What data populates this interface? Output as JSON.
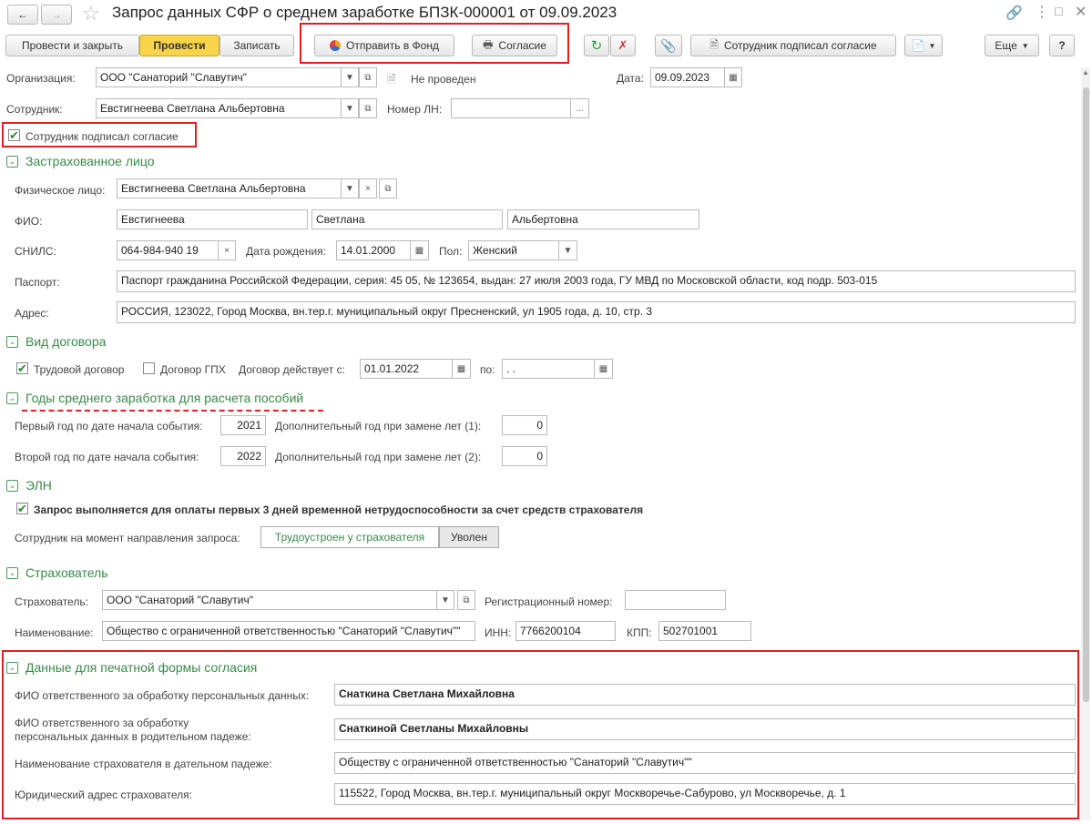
{
  "window": {
    "title": "Запрос данных СФР о среднем заработке  БПЗК-000001 от 09.09.2023"
  },
  "toolbar": {
    "post_close": "Провести и закрыть",
    "post": "Провести",
    "write": "Записать",
    "send_fund": "Отправить в Фонд",
    "consent": "Согласие",
    "employee_signed": "Сотрудник подписал согласие",
    "more": "Еще",
    "help": "?"
  },
  "header": {
    "org_label": "Организация:",
    "org_value": "ООО \"Санаторий \"Славутич\"",
    "status": "Не проведен",
    "date_label": "Дата:",
    "date_value": "09.09.2023",
    "employee_label": "Сотрудник:",
    "employee_value": "Евстигнеева Светлана Альбертовна",
    "ln_label": "Номер ЛН:",
    "ln_value": "",
    "signed_checkbox": "Сотрудник подписал согласие"
  },
  "insured": {
    "section": "Застрахованное лицо",
    "person_label": "Физическое лицо:",
    "person_value": "Евстигнеева Светлана Альбертовна",
    "fio_label": "ФИО:",
    "last": "Евстигнеева",
    "first": "Светлана",
    "middle": "Альбертовна",
    "snils_label": "СНИЛС:",
    "snils": "064-984-940 19",
    "birth_label": "Дата рождения:",
    "birth": "14.01.2000",
    "gender_label": "Пол:",
    "gender": "Женский",
    "passport_label": "Паспорт:",
    "passport": "Паспорт гражданина Российской Федерации, серия: 45 05, № 123654, выдан: 27 июля 2003 года, ГУ МВД по Московской области, код подр. 503-015",
    "address_label": "Адрес:",
    "address": "РОССИЯ, 123022, Город Москва, вн.тер.г. муниципальный округ Пресненский, ул 1905 года, д. 10, стр. 3"
  },
  "contract": {
    "section": "Вид договора",
    "labor": "Трудовой договор",
    "gph": "Договор ГПХ",
    "valid_from_label": "Договор действует с:",
    "valid_from": "01.01.2022",
    "to_label": "по:",
    "to_value": " .  ."
  },
  "years": {
    "section": "Годы среднего заработка для расчета пособий",
    "first_label": "Первый год по дате начала события:",
    "first": "2021",
    "add1_label": "Дополнительный год при замене лет (1):",
    "add1": "0",
    "second_label": "Второй год по дате начала события:",
    "second": "2022",
    "add2_label": "Дополнительный год при замене лет (2):",
    "add2": "0"
  },
  "eln": {
    "section": "ЭЛН",
    "first3days": "Запрос выполняется для оплаты первых 3 дней временной нетрудоспособности за счет средств страхователя",
    "status_label": "Сотрудник на момент направления запроса:",
    "employed": "Трудоустроен у страхователя",
    "fired": "Уволен"
  },
  "insurer": {
    "section": "Страхователь",
    "insurer_label": "Страхователь:",
    "insurer": "ООО \"Санаторий \"Славутич\"",
    "reg_label": "Регистрационный номер:",
    "reg": "",
    "name_label": "Наименование:",
    "name": "Общество с ограниченной ответственностью \"Санаторий \"Славутич\"\"",
    "inn_label": "ИНН:",
    "inn": "7766200104",
    "kpp_label": "КПП:",
    "kpp": "502701001"
  },
  "print": {
    "section": "Данные для печатной формы согласия",
    "resp_label": "ФИО ответственного за обработку персональных данных:",
    "resp": "Снаткина Светлана Михайловна",
    "resp_gen_label1": "ФИО ответственного за обработку",
    "resp_gen_label2": "персональных данных в родительном падеже:",
    "resp_gen": "Снаткиной Светланы Михайловны",
    "insurer_dat_label": "Наименование страхователя в дательном падеже:",
    "insurer_dat": "Обществу с ограниченной ответственностью \"Санаторий \"Славутич\"\"",
    "legal_addr_label": "Юридический адрес страхователя:",
    "legal_addr": "115522, Город Москва, вн.тер.г. муниципальный округ Москворечье-Сабурово, ул Москворечье, д. 1"
  }
}
